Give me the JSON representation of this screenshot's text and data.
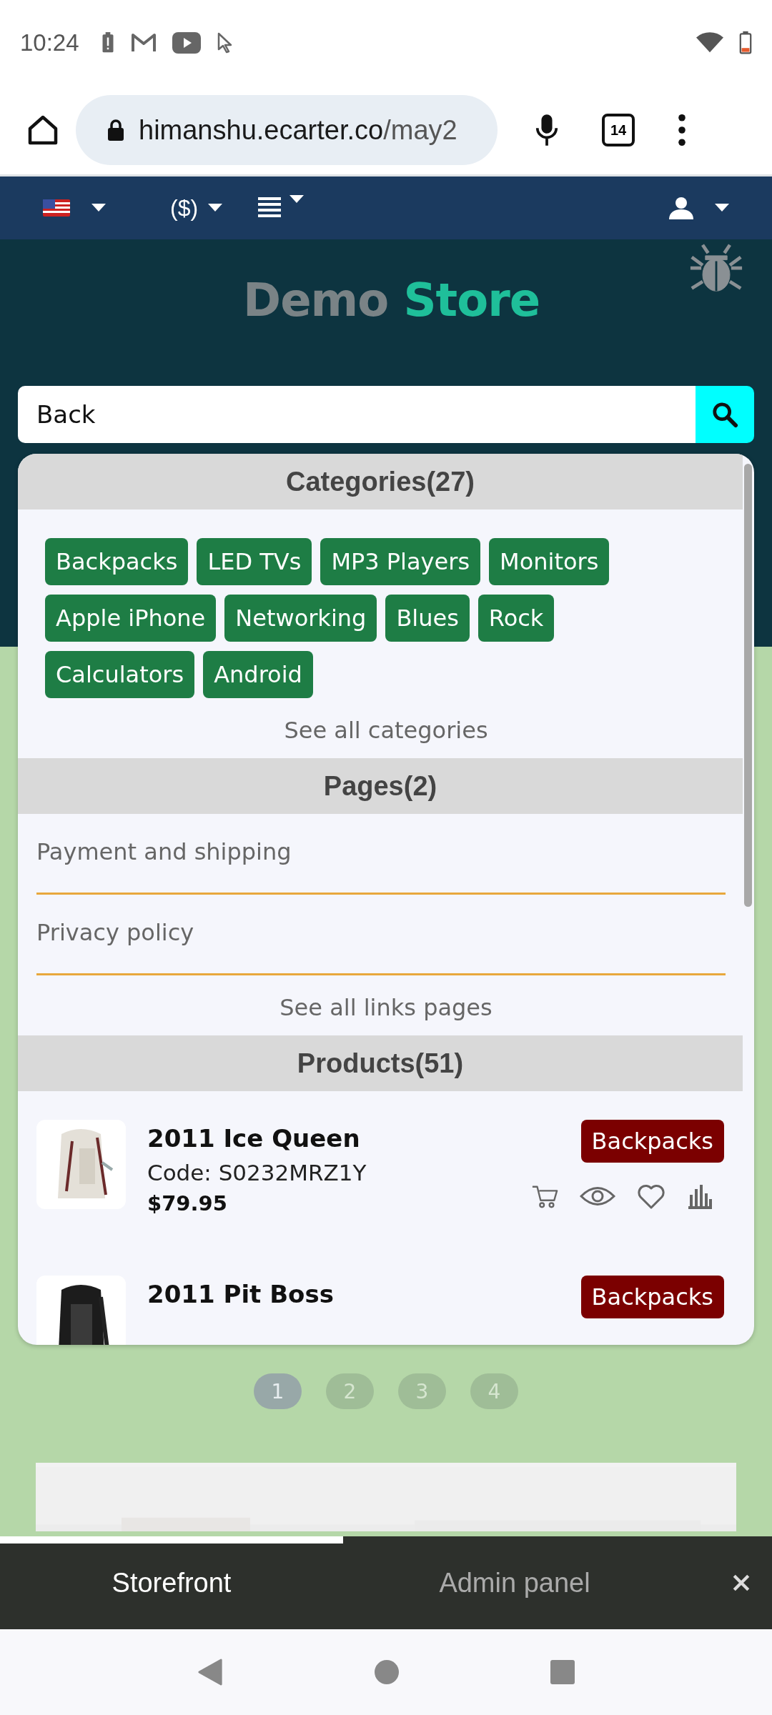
{
  "status_bar": {
    "time": "10:24"
  },
  "browser": {
    "url_host": "himanshu.ecarter.co",
    "url_path": "/may2",
    "tab_count": "14"
  },
  "store_nav": {
    "currency": "($)"
  },
  "logo": {
    "part_1": "Demo",
    "part_2": "Store"
  },
  "search": {
    "value": "Back"
  },
  "categories": {
    "title": "Categories(27)",
    "tags": [
      "Backpacks",
      "LED TVs",
      "MP3 Players",
      "Monitors",
      "Apple iPhone",
      "Networking",
      "Blues",
      "Rock",
      "Calculators",
      "Android"
    ],
    "see_all": "See all categories"
  },
  "pages": {
    "title": "Pages(2)",
    "items": [
      "Payment and shipping",
      "Privacy policy"
    ],
    "see_all": "See all links pages"
  },
  "products": {
    "title": "Products(51)",
    "items": [
      {
        "name": "2011 Ice Queen",
        "code": "Code: S0232MRZ1Y",
        "price": "$79.95",
        "category": "Backpacks"
      },
      {
        "name": "2011 Pit Boss",
        "category": "Backpacks"
      }
    ]
  },
  "pagination": [
    {
      "label": "1",
      "selected": true
    },
    {
      "label": "2",
      "selected": false
    },
    {
      "label": "3",
      "selected": false
    },
    {
      "label": "4",
      "selected": false
    }
  ],
  "bottom_bar": {
    "tabs": [
      {
        "label": "Storefront",
        "selected": true
      },
      {
        "label": "Admin panel",
        "selected": false
      }
    ]
  }
}
